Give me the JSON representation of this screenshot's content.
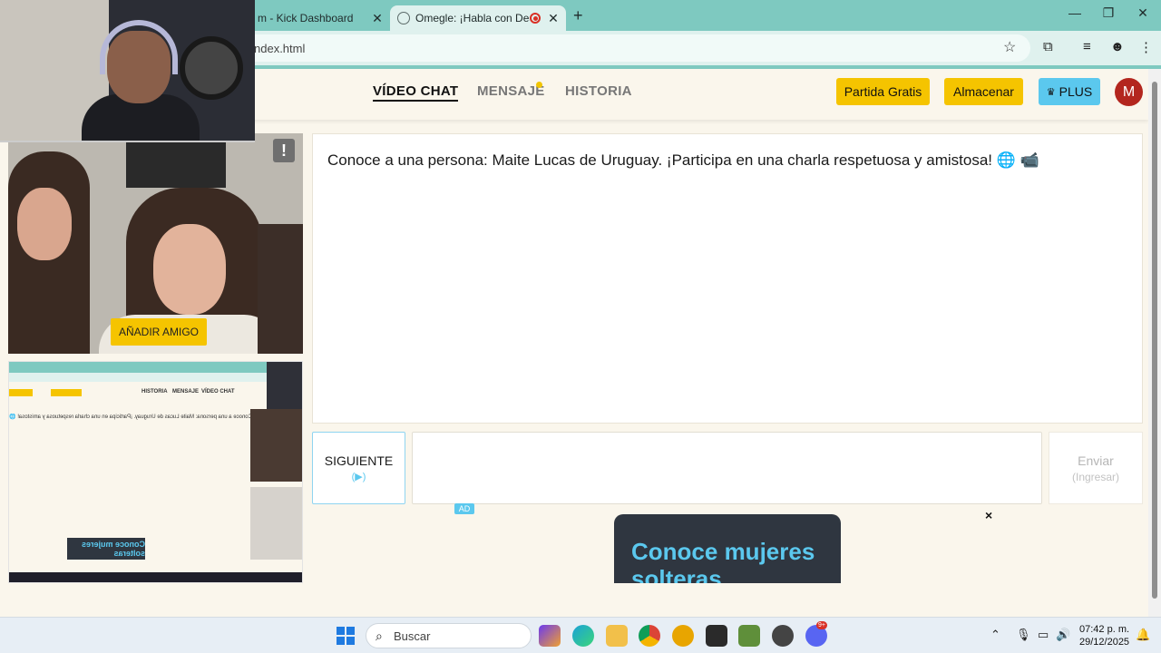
{
  "browser": {
    "tabs": [
      {
        "title": "m - Kick Dashboard",
        "active": false
      },
      {
        "title": "Omegle: ¡Habla con Descon",
        "active": true,
        "recording": true
      }
    ],
    "url": "ndex.html",
    "new_tab_icon": "plus-icon"
  },
  "site": {
    "nav": [
      {
        "label": "VÍDEO CHAT",
        "active": true
      },
      {
        "label": "MENSAJE",
        "active": false,
        "badge": true
      },
      {
        "label": "HISTORIA",
        "active": false
      }
    ],
    "buttons": {
      "free_match": "Partida Gratis",
      "store": "Almacenar",
      "plus": "PLUS"
    },
    "avatar_letter": "M"
  },
  "video": {
    "report_icon": "!",
    "add_friend": "AÑADIR AMIGO"
  },
  "self_preview": {
    "nav": [
      "VÍDEO CHAT",
      "MENSAJE",
      "HISTORIA"
    ],
    "ad_text": "Conoce mujeres solteras"
  },
  "chat": {
    "message": "Conoce a una persona: Maite Lucas de Uruguay. ¡Participa en una charla respetuosa y amistosa! 🌐 📹",
    "next_label": "SIGUIENTE",
    "next_hint": "(▶)",
    "send_label": "Enviar",
    "send_hint": "(Ingresar)"
  },
  "ad": {
    "tag": "AD",
    "close": "×",
    "headline": "Conoce mujeres solteras"
  },
  "taskbar": {
    "search_placeholder": "Buscar",
    "time": "07:42 p. m.",
    "date": "29/12/2025",
    "discord_badge": "9+"
  },
  "colors": {
    "accent_yellow": "#f5c400",
    "accent_blue": "#5bc8ee",
    "chrome_teal": "#7ec9c0",
    "avatar_red": "#b3261e"
  }
}
